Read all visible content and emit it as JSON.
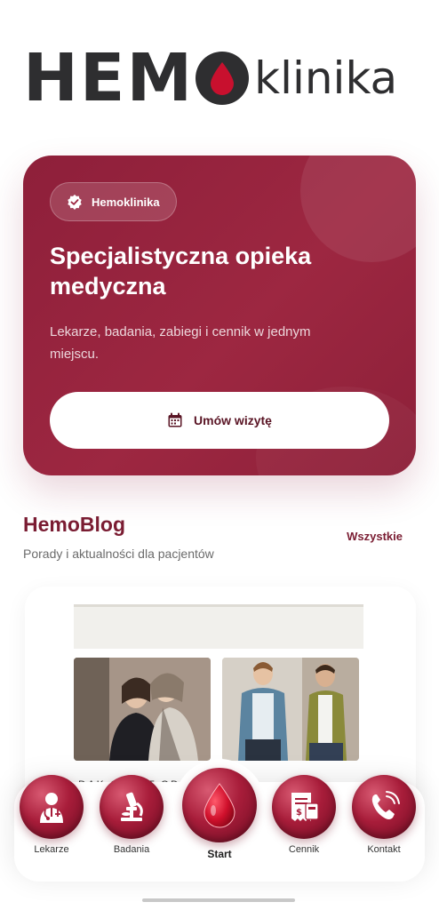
{
  "logo": {
    "hemo": "HEM",
    "klinika": "klinika"
  },
  "hero": {
    "badge": "Hemoklinika",
    "title": "Specjalistyczna opieka medyczna",
    "subtitle": "Lekarze, badania, zabiegi i cennik w jednym miejscu.",
    "cta_label": "Umów wizytę"
  },
  "blog": {
    "title": "HemoBlog",
    "subtitle": "Porady i aktualności dla pacjentów",
    "all_label": "Wszystkie",
    "caption_fragment": "DAK   OR   P   T   OD"
  },
  "nav": {
    "items": [
      {
        "label": "Lekarze",
        "icon": "doctor-icon"
      },
      {
        "label": "Badania",
        "icon": "microscope-icon"
      },
      {
        "label": "Start",
        "icon": "blood-drop-icon"
      },
      {
        "label": "Cennik",
        "icon": "price-list-icon"
      },
      {
        "label": "Kontakt",
        "icon": "phone-icon"
      }
    ]
  },
  "colors": {
    "brand": "#9d2741",
    "logo_dark": "#2e2e30",
    "drop": "#c8102e"
  }
}
